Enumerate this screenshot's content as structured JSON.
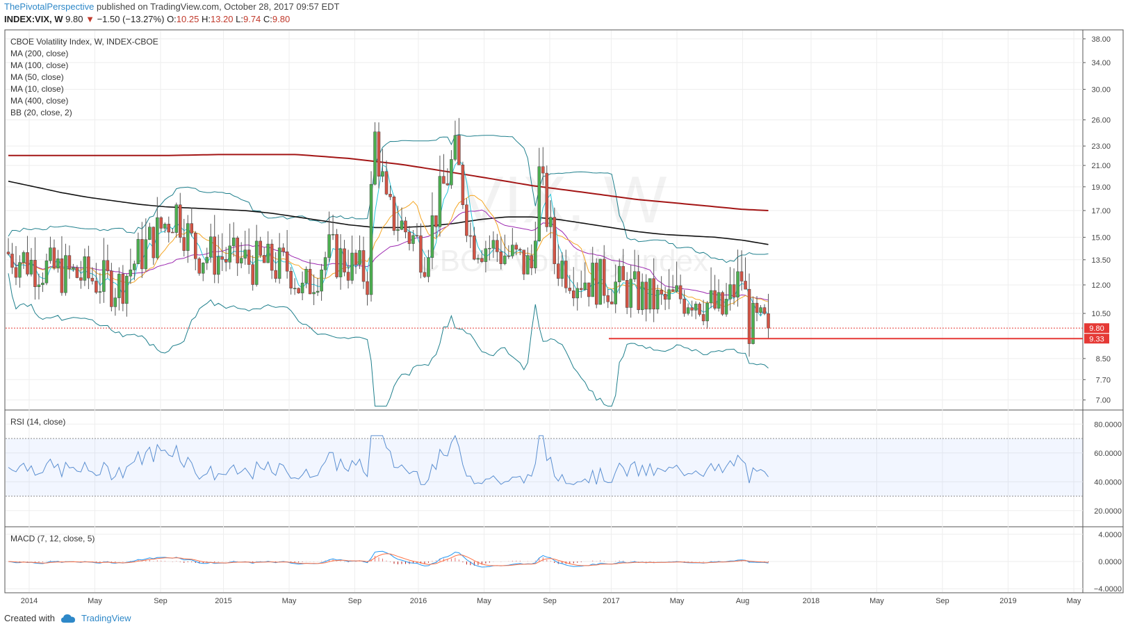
{
  "header": {
    "publisher": "ThePivotalPerspective",
    "published_text": "published on TradingView.com, October 28, 2017 09:57 EDT",
    "symbol": "INDEX:VIX, W",
    "last": "9.80",
    "down_arrow": "▼",
    "change": "−1.50 (−13.27%)",
    "o_label": "O:",
    "o_value": "10.25",
    "h_label": "H:",
    "h_value": "13.20",
    "l_label": "L:",
    "l_value": "9.74",
    "c_label": "C:",
    "c_value": "9.80"
  },
  "legend": {
    "title": "CBOE Volatility Index, W, INDEX-CBOE",
    "ma200": "MA (200, close)",
    "ma100": "MA (100, close)",
    "ma50": "MA (50, close)",
    "ma10": "MA (10, close)",
    "ma400": "MA (400, close)",
    "bb": "BB (20, close, 2)"
  },
  "watermark": {
    "symbol": "VIX, W",
    "name": "CBOE Volatility Index"
  },
  "rsi_label": "RSI (14, close)",
  "macd_label": "MACD (7, 12, close, 5)",
  "footer": {
    "created_with": "Created with",
    "brand": "TradingView"
  },
  "colors": {
    "up": "#4caf50",
    "down": "#d35445",
    "ma400": "#a31515",
    "ma200": "#111111",
    "ma100": "#9c27b0",
    "ma50": "#f5a623",
    "ma10": "#26c6da",
    "bb": "#1e7f8c",
    "rsi": "#5b8fd1",
    "support": "#e53935"
  },
  "chart_data": {
    "type": "candlestick",
    "price_axis": {
      "ticks": [
        "38.00",
        "34.00",
        "30.00",
        "26.00",
        "23.00",
        "21.00",
        "19.00",
        "17.00",
        "15.00",
        "13.50",
        "12.00",
        "10.50",
        "9.80",
        "9.33",
        "8.50",
        "7.70",
        "7.00"
      ],
      "scale": "log",
      "range": [
        6.7,
        39.5
      ]
    },
    "time_axis": {
      "labels": [
        "2014",
        "May",
        "Sep",
        "2015",
        "May",
        "Sep",
        "2016",
        "May",
        "Sep",
        "2017",
        "May",
        "Aug",
        "2018",
        "May",
        "Sep",
        "2019",
        "May"
      ]
    },
    "last_price_label": "9.80",
    "support_line_label": "9.33",
    "support_level": 9.33,
    "candles": [],
    "overlays": {
      "ma400": [
        22.0,
        22.0,
        22.0,
        22.0,
        22.0,
        22.0,
        22.0,
        22.05,
        22.1,
        22.1,
        22.1,
        22.1,
        21.9,
        21.7,
        21.4,
        21.1,
        20.7,
        20.3,
        19.9,
        19.5,
        19.1,
        18.8,
        18.5,
        18.2,
        17.9,
        17.7,
        17.5,
        17.3,
        17.1,
        17.0
      ],
      "ma200": [
        19.5,
        19.0,
        18.5,
        18.1,
        17.8,
        17.5,
        17.3,
        17.2,
        17.1,
        17.0,
        16.8,
        16.5,
        16.2,
        15.9,
        15.7,
        15.7,
        15.8,
        16.0,
        16.3,
        16.5,
        16.5,
        16.3,
        16.0,
        15.7,
        15.4,
        15.2,
        15.1,
        15.0,
        14.8,
        14.5
      ]
    },
    "rsi": {
      "ticks": [
        "80.0000",
        "60.0000",
        "40.0000",
        "20.0000"
      ],
      "band": [
        30,
        70
      ]
    },
    "macd": {
      "ticks": [
        "4.0000",
        "0.0000",
        "-4.0000"
      ]
    }
  }
}
